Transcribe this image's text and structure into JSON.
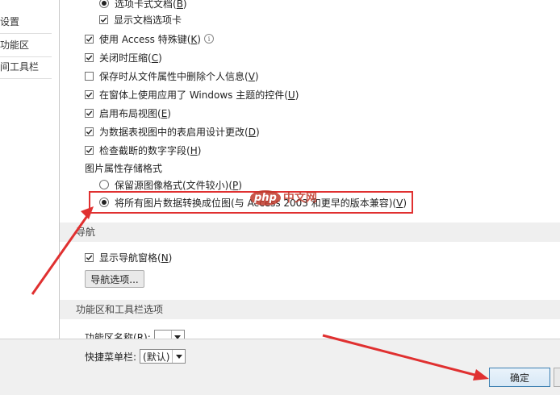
{
  "left_nav": {
    "items": [
      {
        "label": "设置"
      },
      {
        "label": "功能区"
      },
      {
        "label": "间工具栏"
      }
    ]
  },
  "options": {
    "tabbed_docs": {
      "label": "选项卡式文档(",
      "key": "B",
      "suffix": ")",
      "selected": true
    },
    "show_doc_tabs": {
      "label": "显示文档选项卡",
      "checked": true
    },
    "access_special_keys": {
      "label": "使用 Access 特殊键(",
      "key": "K",
      "suffix": ")",
      "checked": true,
      "info_glyph": "i"
    },
    "compact_on_close": {
      "label": "关闭时压缩(",
      "key": "C",
      "suffix": ")",
      "checked": true
    },
    "remove_personal_info": {
      "label": "保存时从文件属性中删除个人信息(",
      "key": "V",
      "suffix": ")",
      "checked": false
    },
    "windows_theme_controls": {
      "label": "在窗体上使用应用了 Windows 主题的控件(",
      "key": "U",
      "suffix": ")",
      "checked": true
    },
    "layout_view": {
      "label": "启用布局视图(",
      "key": "E",
      "suffix": ")",
      "checked": true
    },
    "design_changes": {
      "label": "为数据表视图中的表启用设计更改(",
      "key": "D",
      "suffix": ")",
      "checked": true
    },
    "truncated_numbers": {
      "label": "检查截断的数字字段(",
      "key": "H",
      "suffix": ")",
      "checked": true
    }
  },
  "picture_format": {
    "heading": "图片属性存储格式",
    "preserve": {
      "label": "保留源图像格式(文件较小)(",
      "key": "P",
      "suffix": ")",
      "selected": false
    },
    "convert": {
      "label": "将所有图片数据转换成位图(与 Access 2003 和更早的版本兼容)(",
      "key": "V",
      "suffix": ")",
      "selected": true
    }
  },
  "navigation": {
    "header": "导航",
    "show_nav_pane": {
      "label": "显示导航窗格(",
      "key": "N",
      "suffix": ")",
      "checked": true
    },
    "nav_options_button": "导航选项..."
  },
  "ribbon": {
    "header": "功能区和工具栏选项",
    "ribbon_name": {
      "label": "功能区名称(",
      "key": "R",
      "suffix": "):",
      "value": ""
    },
    "shortcut_menu": {
      "label": "快捷菜单栏:",
      "value": "(默认)"
    }
  },
  "footer": {
    "ok_label": "确定"
  },
  "watermark": {
    "logo": "php",
    "text": "中文网"
  },
  "colors": {
    "highlight": "#e03030",
    "arrow": "#e03030",
    "accent_button": "#3c7fb1"
  }
}
